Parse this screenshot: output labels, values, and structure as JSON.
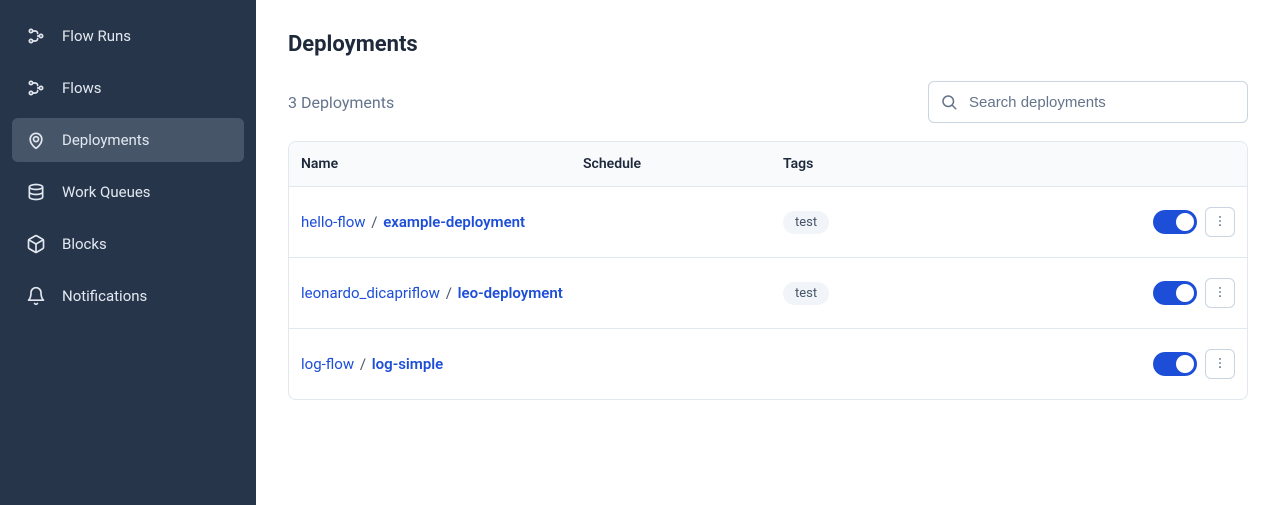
{
  "sidebar": {
    "items": [
      {
        "label": "Flow Runs",
        "icon": "flow-runs-icon",
        "active": false
      },
      {
        "label": "Flows",
        "icon": "flows-icon",
        "active": false
      },
      {
        "label": "Deployments",
        "icon": "deployments-icon",
        "active": true
      },
      {
        "label": "Work Queues",
        "icon": "work-queues-icon",
        "active": false
      },
      {
        "label": "Blocks",
        "icon": "blocks-icon",
        "active": false
      },
      {
        "label": "Notifications",
        "icon": "notifications-icon",
        "active": false
      }
    ]
  },
  "page": {
    "title": "Deployments",
    "count_label": "3 Deployments"
  },
  "search": {
    "placeholder": "Search deployments",
    "value": ""
  },
  "table": {
    "headers": {
      "name": "Name",
      "schedule": "Schedule",
      "tags": "Tags"
    },
    "rows": [
      {
        "flow": "hello-flow",
        "deployment": "example-deployment",
        "schedule": "",
        "tags": [
          "test"
        ],
        "enabled": true
      },
      {
        "flow": "leonardo_dicapriflow",
        "deployment": "leo-deployment",
        "schedule": "",
        "tags": [
          "test"
        ],
        "enabled": true
      },
      {
        "flow": "log-flow",
        "deployment": "log-simple",
        "schedule": "",
        "tags": [],
        "enabled": true
      }
    ]
  },
  "colors": {
    "sidebar_bg": "#27354a",
    "sidebar_active_bg": "#475569",
    "accent": "#1d4ed8",
    "text": "#1e293b",
    "muted": "#64748b",
    "border": "#e2e8f0",
    "tag_bg": "#f1f5f9"
  }
}
